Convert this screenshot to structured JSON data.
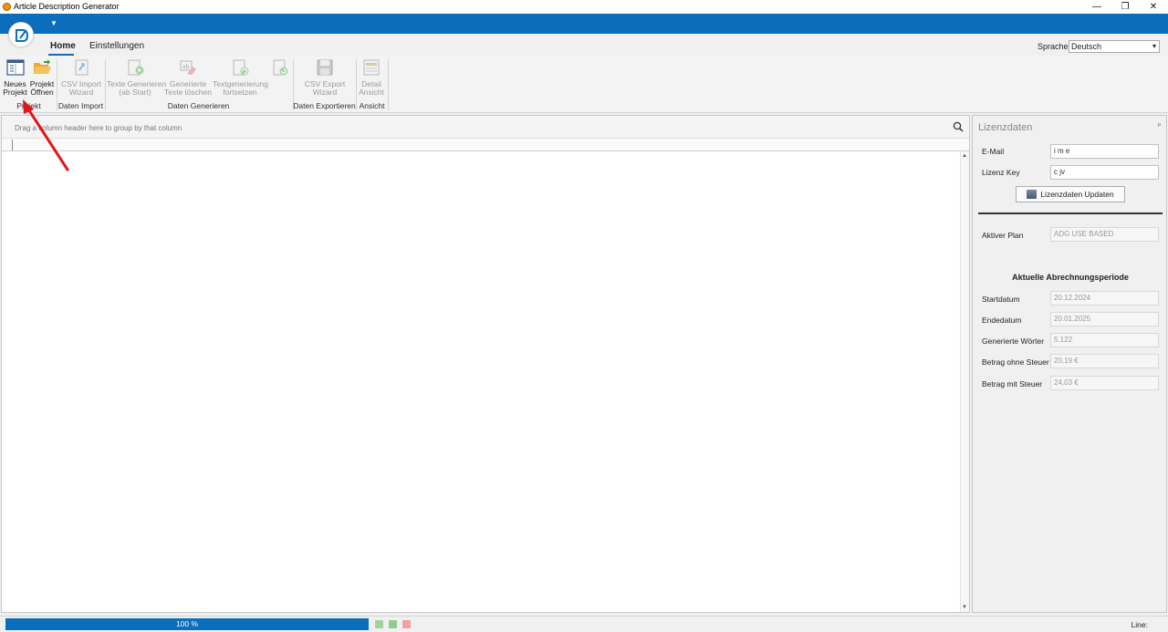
{
  "window": {
    "title": "Article Description Generator",
    "minimize": "—",
    "maximize": "❐",
    "close": "✕"
  },
  "qat": {
    "dropdown": "▼"
  },
  "tabs": [
    {
      "label": "Home"
    },
    {
      "label": "Einstellungen"
    }
  ],
  "language": {
    "label": "Sprache:",
    "value": "Deutsch",
    "caret": "▾"
  },
  "ribbon": {
    "buttons": [
      {
        "label": "Neues\nProjekt",
        "icon": "new-project-icon",
        "enabled": true
      },
      {
        "label": "Projekt\nÖffnen",
        "icon": "open-folder-icon",
        "enabled": true
      },
      {
        "label": "CSV Import\nWizard",
        "icon": "csv-import-icon",
        "enabled": false
      },
      {
        "label": "Texte Generieren\n(ab Start)",
        "icon": "generate-texts-icon",
        "enabled": false
      },
      {
        "label": "Generierte\nTexte löschen",
        "icon": "delete-texts-icon",
        "enabled": false
      },
      {
        "label": "Textgenerierung\nfortsetzen",
        "icon": "continue-generation-icon",
        "enabled": false
      },
      {
        "label": "",
        "icon": "refresh-icon",
        "enabled": false
      },
      {
        "label": "CSV Export\nWizard",
        "icon": "csv-export-icon",
        "enabled": false
      },
      {
        "label": "Detail\nAnsicht",
        "icon": "detail-view-icon",
        "enabled": false
      }
    ],
    "groups": [
      "Projekt",
      "Daten Import",
      "Daten Generieren",
      "Daten Exportieren",
      "Ansicht"
    ]
  },
  "grid": {
    "group_hint": "Drag a column header here to group by that column",
    "scroll_up": "▲",
    "scroll_down": "▼"
  },
  "license": {
    "title": "Lizenzdaten",
    "pin": "ᵖ",
    "email_label": "E-Mail",
    "email_value": "        i      m       e",
    "key_label": "Lizenz Key",
    "key_value": "c          jv",
    "update_button": "Lizenzdaten Updaten",
    "plan_label": "Aktiver Plan",
    "plan_value": "ADG USE BASED",
    "period_title": "Aktuelle Abrechnungsperiode",
    "start_label": "Startdatum",
    "start_value": "20.12.2024",
    "end_label": "Endedatum",
    "end_value": "20.01.2025",
    "words_label": "Generierte Wörter",
    "words_value": "5.122",
    "net_label": "Betrag ohne Steuer",
    "net_value": "20,19 €",
    "gross_label": "Betrag mit Steuer",
    "gross_value": "24,03 €"
  },
  "status": {
    "progress_text": "100 %",
    "progress_fraction": 1.0,
    "line_label": "Line:"
  },
  "colors": {
    "accent": "#0a6ebd",
    "arrow": "#e3151a"
  }
}
